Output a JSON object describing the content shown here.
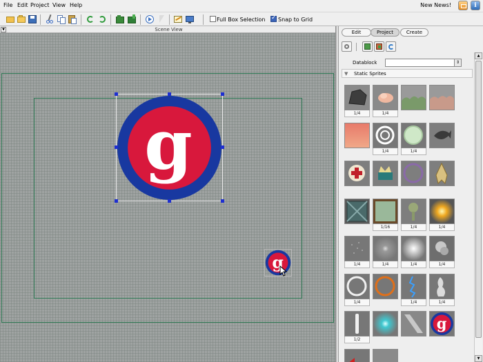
{
  "menu": {
    "items": [
      "File",
      "Edit",
      "Project",
      "View",
      "Help"
    ]
  },
  "news": {
    "label": "New News!"
  },
  "toolbar": {
    "full_box_selection_label": "Full Box Selection",
    "full_box_selection_checked": false,
    "snap_to_grid_label": "Snap to Grid",
    "snap_to_grid_checked": true
  },
  "scene": {
    "title": "Scene View"
  },
  "panel": {
    "tabs": [
      {
        "label": "Edit",
        "active": false
      },
      {
        "label": "Project",
        "active": true
      },
      {
        "label": "Create",
        "active": false
      }
    ],
    "datablock_label": "Datablock",
    "datablock_value": "",
    "section_title": "Static Sprites"
  },
  "sprites": [
    {
      "name": "rock",
      "label": "1/4"
    },
    {
      "name": "pink-shell",
      "label": "1/4"
    },
    {
      "name": "green-hills",
      "label": ""
    },
    {
      "name": "red-hills",
      "label": ""
    },
    {
      "name": "sunset-gradient",
      "label": ""
    },
    {
      "name": "white-spiral",
      "label": "1/4"
    },
    {
      "name": "green-glow-orb",
      "label": "1/4"
    },
    {
      "name": "dark-fish",
      "label": ""
    },
    {
      "name": "health-cross",
      "label": ""
    },
    {
      "name": "crown-emblem",
      "label": ""
    },
    {
      "name": "purple-ring",
      "label": ""
    },
    {
      "name": "gold-ship",
      "label": ""
    },
    {
      "name": "metal-crate",
      "label": ""
    },
    {
      "name": "green-frame",
      "label": "1/16"
    },
    {
      "name": "tree-tiles",
      "label": "1/4"
    },
    {
      "name": "yellow-spark",
      "label": "1/4"
    },
    {
      "name": "dots-particles",
      "label": "1/4"
    },
    {
      "name": "small-glow",
      "label": "1/4"
    },
    {
      "name": "white-flare",
      "label": "1/4"
    },
    {
      "name": "smoke-puff",
      "label": "1/4"
    },
    {
      "name": "white-ring",
      "label": "1/4"
    },
    {
      "name": "orange-ring",
      "label": ""
    },
    {
      "name": "lightning",
      "label": "1/4"
    },
    {
      "name": "white-smoke",
      "label": "1/4"
    },
    {
      "name": "light-bar",
      "label": "1/2"
    },
    {
      "name": "cyan-glow",
      "label": ""
    },
    {
      "name": "streak",
      "label": ""
    },
    {
      "name": "g-logo",
      "label": ""
    },
    {
      "name": "red-arrow",
      "label": ""
    },
    {
      "name": "gray-tile",
      "label": ""
    }
  ],
  "colors": {
    "logo_red": "#d8183c",
    "logo_blue": "#1838a0",
    "frame_green": "#2f7a55",
    "scene_gray": "#9fa3a2"
  }
}
